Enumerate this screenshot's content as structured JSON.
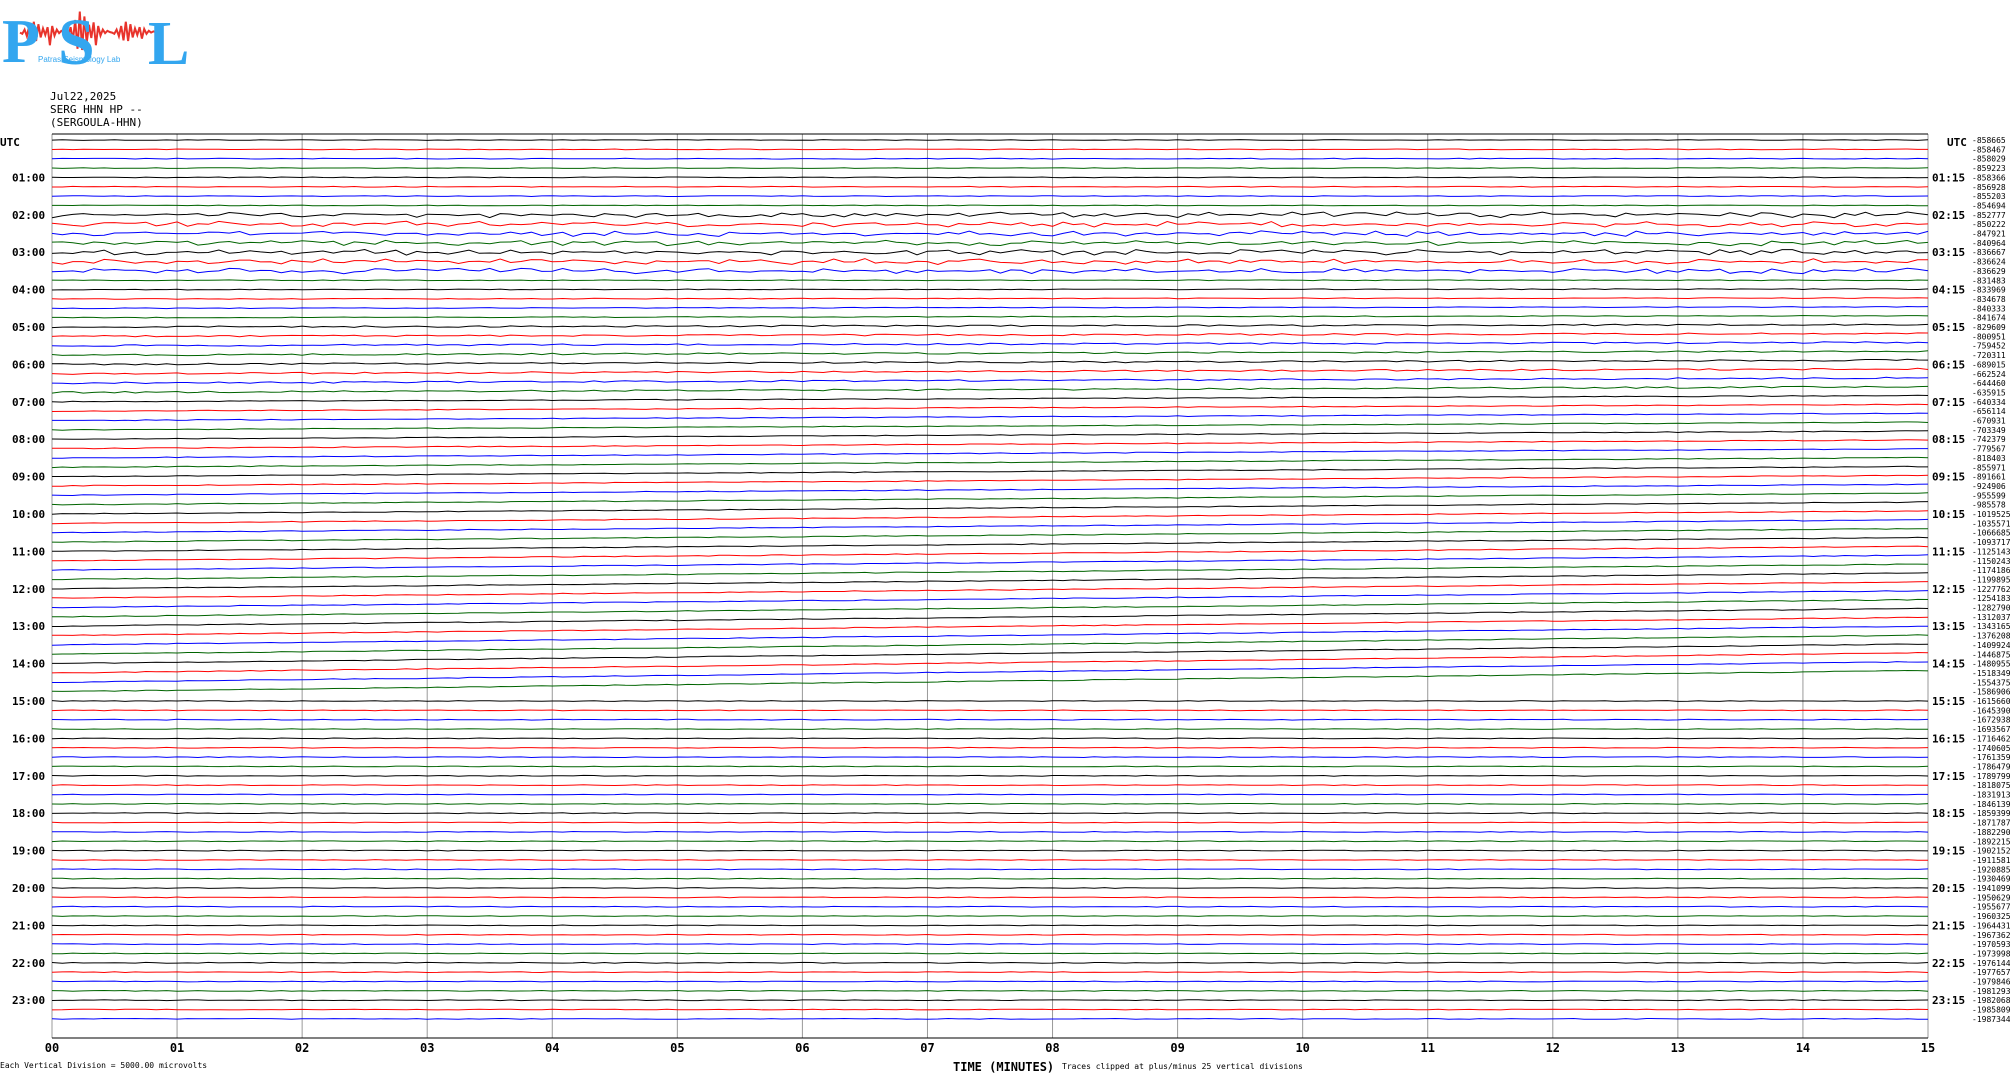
{
  "logo": {
    "letters": "PSL",
    "subtitle": "Patras Seismology Lab",
    "colors": {
      "letters": "#33a6ef",
      "squiggle": "#e8332b",
      "accent": "#b0122a"
    }
  },
  "header": {
    "date": "Jul22,2025",
    "station": "SERG HHN HP --",
    "name": "(SERGOULA-HHN)"
  },
  "colors": {
    "trace": [
      "#000000",
      "#ff0000",
      "#0000ff",
      "#006400"
    ],
    "grid": "#999999"
  },
  "chart_data": {
    "type": "line",
    "title": "Jul22,2025 SERG HHN HP -- (SERGOULA-HHN)",
    "xlabel": "TIME (MINUTES)",
    "x_ticks": [
      "00",
      "01",
      "02",
      "03",
      "04",
      "05",
      "06",
      "07",
      "08",
      "09",
      "10",
      "11",
      "12",
      "13",
      "14",
      "15"
    ],
    "xlim": [
      0,
      15
    ],
    "left_axis_label": "UTC",
    "right_axis_label": "UTC",
    "left_hour_labels": [
      "01:00",
      "02:00",
      "03:00",
      "04:00",
      "05:00",
      "06:00",
      "07:00",
      "08:00",
      "09:00",
      "10:00",
      "11:00",
      "12:00",
      "13:00",
      "14:00",
      "15:00",
      "16:00",
      "17:00",
      "18:00",
      "19:00",
      "20:00",
      "21:00",
      "22:00",
      "23:00"
    ],
    "right_hour_labels": [
      "01:15",
      "02:15",
      "03:15",
      "04:15",
      "05:15",
      "06:15",
      "07:15",
      "08:15",
      "09:15",
      "10:15",
      "11:15",
      "12:15",
      "13:15",
      "14:15",
      "15:15",
      "16:15",
      "17:15",
      "18:15",
      "19:15",
      "20:15",
      "21:15",
      "22:15",
      "23:15"
    ],
    "traces_per_hour": 4,
    "trace_minutes": 15,
    "trace_offsets": [
      -858665,
      -858467,
      -858029,
      -859223,
      -858366,
      -856928,
      -855203,
      -854694,
      -852777,
      -850222,
      -847921,
      -840964,
      -836667,
      -836624,
      -836629,
      -831483,
      -833969,
      -834678,
      -840333,
      -841674,
      -829609,
      -800951,
      -759452,
      -720311,
      -689015,
      -662524,
      -644460,
      -635915,
      -640334,
      -656114,
      -670931,
      -703349,
      -742379,
      -779567,
      -818403,
      -855971,
      -891661,
      -924906,
      -955599,
      -985578,
      -1019525,
      -1035571,
      -1066685,
      -1093717,
      -1125143,
      -1150243,
      -1174186,
      -1199895,
      -1227762,
      -1254183,
      -1282790,
      -1312037,
      -1343165,
      -1376208,
      -1409924,
      -1446875,
      -1480955,
      -1518349,
      -1554375,
      -1586906,
      -1615660,
      -1645390,
      -1672938,
      -1693567,
      -1716462,
      -1740605,
      -1761359,
      -1786479,
      -1789799,
      -1818075,
      -1831913,
      -1846139,
      -1859399,
      -1871787,
      -1882290,
      -1892215,
      -1902152,
      -1911581,
      -1920885,
      -1930469,
      -1941099,
      -1950629,
      -1955677,
      -1960325,
      -1964431,
      -1967362,
      -1970593,
      -1973998,
      -1976144,
      -1977657,
      -1979846,
      -1981293,
      -1982068,
      -1985809,
      -1987344
    ],
    "bottom_left_note": "Each Vertical Division = 5000.00 microvolts",
    "bottom_right_note": "Traces clipped at plus/minus 25 vertical divisions"
  }
}
